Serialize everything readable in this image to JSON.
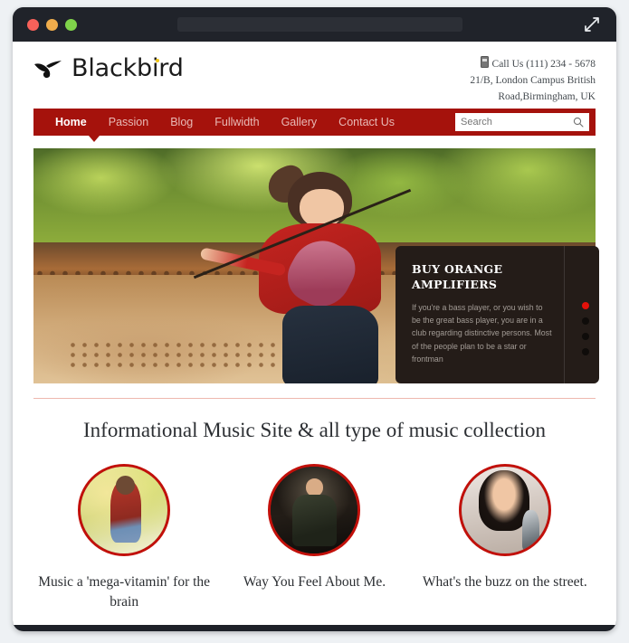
{
  "window": {
    "traffic_lights": [
      "close",
      "minimize",
      "maximize"
    ],
    "address_value": "",
    "expand_icon": "expand-arrows-icon",
    "chrome_color": "#20232a"
  },
  "site": {
    "logo": {
      "text": "Blackbird",
      "icon": "bird-icon",
      "dot_color": "#f2c617"
    },
    "contact": {
      "phone_icon": "mobile-phone-icon",
      "phone_label": "Call Us (111) 234 - 5678",
      "address_line_1": "21/B, London Campus British",
      "address_line_2": "Road,Birmingham, UK"
    },
    "nav": {
      "accent_color": "#a5120c",
      "items": [
        {
          "label": "Home",
          "active": true
        },
        {
          "label": "Passion",
          "active": false
        },
        {
          "label": "Blog",
          "active": false
        },
        {
          "label": "Fullwidth",
          "active": false
        },
        {
          "label": "Gallery",
          "active": false
        },
        {
          "label": "Contact Us",
          "active": false
        }
      ],
      "search": {
        "placeholder": "Search",
        "value": "",
        "icon": "search-icon"
      }
    },
    "slider": {
      "image_alt": "Woman playing violin outdoors on a rusty bridge",
      "caption": {
        "title": "BUY ORANGE AMPLIFIERS",
        "text": "If you're a bass player, or you wish to be the great bass player, you are in a club regarding distinctive persons. Most of the people plan to be a star or frontman"
      },
      "bullets": [
        {
          "active": true
        },
        {
          "active": false
        },
        {
          "active": false
        },
        {
          "active": false
        }
      ],
      "active_bullet_color": "#e3110a"
    },
    "section": {
      "divider_color": "#eeb8ae",
      "heading": "Informational Music Site & all type of music collection",
      "cards": [
        {
          "thumb": "violinist-thumbnail",
          "caption": "Music a 'mega-vitamin' for the brain"
        },
        {
          "thumb": "guitarist-thumbnail",
          "caption": "Way You Feel About Me."
        },
        {
          "thumb": "singer-thumbnail",
          "caption": "What's the buzz on the street."
        }
      ],
      "circle_border_color": "#c2100a"
    }
  }
}
